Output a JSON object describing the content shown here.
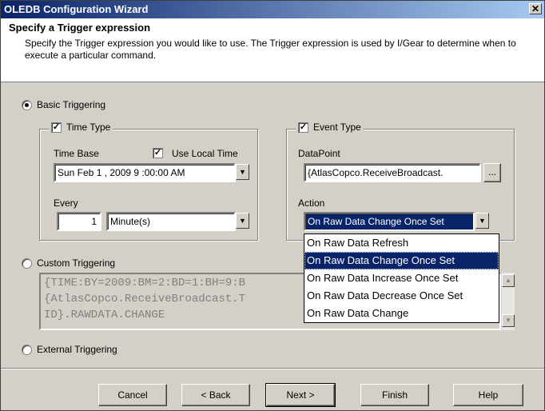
{
  "window": {
    "title": "OLEDB Configuration Wizard",
    "close_glyph": "✕"
  },
  "header": {
    "title": "Specify a Trigger expression",
    "description": "Specify the Trigger expression you would like to use.  The Trigger expression is used by I/Gear to determine when to execute a particular command."
  },
  "triggering": {
    "basic_label": "Basic Triggering",
    "custom_label": "Custom Triggering",
    "external_label": "External Triggering",
    "selected": "basic"
  },
  "time_type": {
    "label": "Time Type",
    "checked": true,
    "time_base_label": "Time Base",
    "use_local_time_label": "Use Local Time",
    "use_local_time_checked": true,
    "time_base_value": "Sun Feb  1 , 2009  9 :00:00 AM",
    "every_label": "Every",
    "every_value": "1",
    "unit_value": "Minute(s)"
  },
  "event_type": {
    "label": "Event Type",
    "checked": true,
    "datapoint_label": "DataPoint",
    "datapoint_value": "{AtlasCopco.ReceiveBroadcast.",
    "browse_label": "...",
    "action_label": "Action",
    "action_value": "On Raw Data Change Once Set",
    "action_options": [
      "On Raw Data Refresh",
      "On Raw Data Change Once Set",
      "On Raw Data Increase Once Set",
      "On Raw Data Decrease Once Set",
      "On Raw Data Change"
    ],
    "selected_option_index": 1
  },
  "custom_expression": {
    "lines": [
      "{TIME:BY=2009:BM=2:BD=1:BH=9:B",
      "{AtlasCopco.ReceiveBroadcast.T",
      "ID}.RAWDATA.CHANGE"
    ]
  },
  "buttons": {
    "cancel": "Cancel",
    "back": "< Back",
    "next": "Next >",
    "finish": "Finish",
    "help": "Help"
  },
  "glyphs": {
    "check": "✓",
    "down_arrow": "▼",
    "up_arrow": "▲"
  },
  "colors": {
    "selection": "#0a246a",
    "titlebar": "#0a246a",
    "face": "#d4d0c8"
  }
}
